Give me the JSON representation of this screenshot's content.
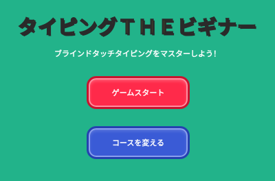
{
  "title": "タイピングＴＨＥビギナー",
  "subtitle": "ブラインドタッチタイピングをマスターしよう！",
  "buttons": {
    "start_label": "ゲームスタート",
    "course_label": "コースを変える"
  },
  "colors": {
    "background": "#22b38a",
    "title": "#ffe71a",
    "start_button": "#ff2a4a",
    "course_button": "#3a5bd6"
  }
}
